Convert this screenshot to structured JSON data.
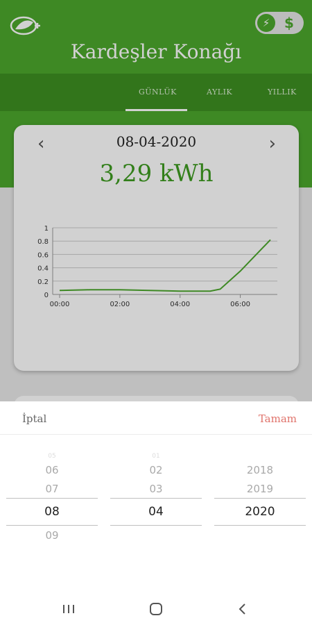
{
  "header": {
    "title": "Kardeşler Konağı",
    "toggle_icons": [
      "lightning-icon",
      "dollar-icon"
    ],
    "toggle_dollar": "$",
    "logo_icon": "eco-plug-logo-icon"
  },
  "tabs": [
    {
      "label": "GÜNLÜK",
      "active": true
    },
    {
      "label": "AYLIK",
      "active": false
    },
    {
      "label": "YILLIK",
      "active": false
    }
  ],
  "card": {
    "date": "08-04-2020",
    "energy": "3,29 kWh",
    "prev_icon": "chevron-left-icon",
    "next_icon": "chevron-right-icon"
  },
  "chart_data": {
    "type": "line",
    "x": [
      "00:00",
      "01:00",
      "02:00",
      "03:00",
      "04:00",
      "05:00",
      "05:20",
      "06:00",
      "07:00"
    ],
    "series": [
      {
        "values": [
          0.06,
          0.07,
          0.07,
          0.06,
          0.05,
          0.05,
          0.08,
          0.35,
          0.82
        ]
      }
    ],
    "xticks": [
      "00:00",
      "02:00",
      "04:00",
      "06:00"
    ],
    "yticks": [
      "0",
      "0.2",
      "0.4",
      "0.6",
      "0.8",
      "1"
    ],
    "ylim": [
      0,
      1
    ],
    "grid": true,
    "color": "#4ca82d"
  },
  "picker": {
    "cancel": "İptal",
    "done": "Tamam",
    "month": {
      "faint": "05",
      "items": [
        "06",
        "07"
      ],
      "selected": "08",
      "after": "09"
    },
    "day": {
      "faint": "01",
      "items": [
        "02",
        "03"
      ],
      "selected": "04"
    },
    "year": {
      "items": [
        "2018",
        "2019"
      ],
      "selected": "2020"
    }
  },
  "colors": {
    "brand": "#4ca82d",
    "brand_dark": "#3e8f22",
    "accent_done": "#e0736b"
  }
}
